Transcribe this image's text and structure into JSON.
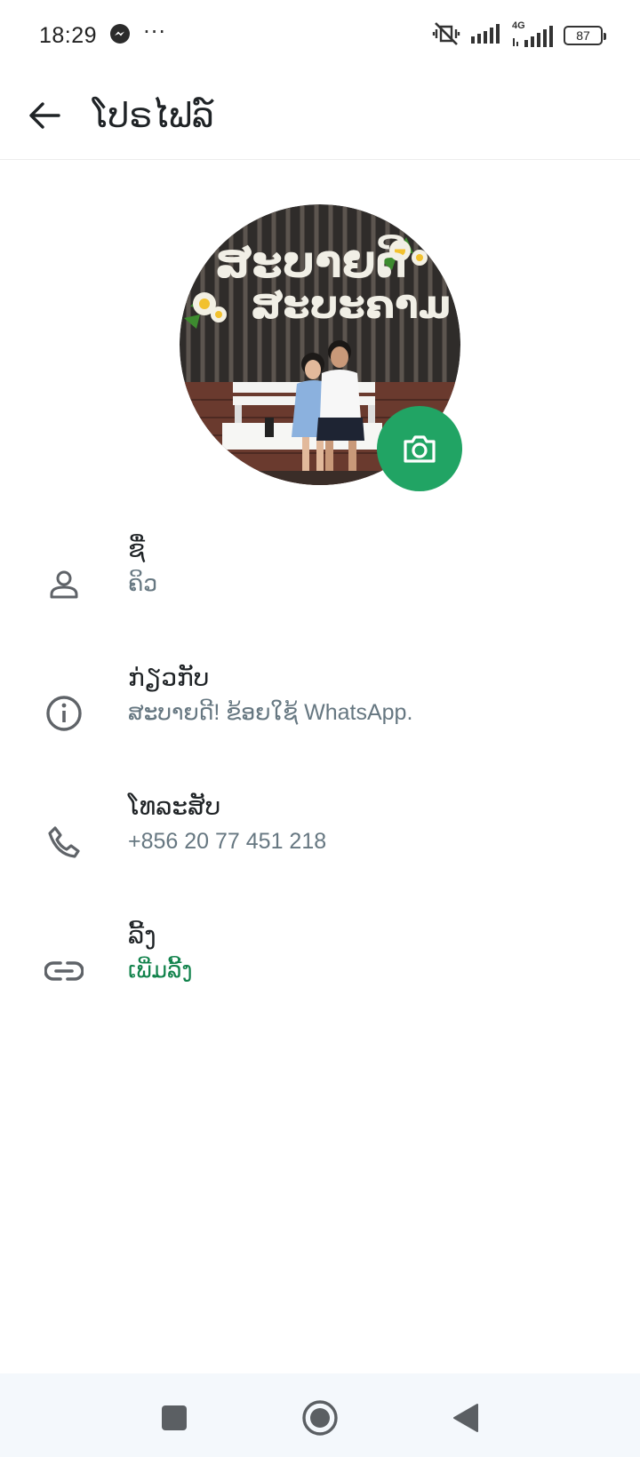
{
  "status_bar": {
    "time": "18:29",
    "dots": "···",
    "battery": "87",
    "network": "4G",
    "icons": [
      "messenger-icon",
      "mute-icon",
      "signal-icon",
      "signal-4g-icon",
      "battery-icon"
    ]
  },
  "header": {
    "title": "ໂປຣໄຟລ໌"
  },
  "avatar": {
    "sign_line1": "ສະບາຍດີ",
    "sign_line2": "ສະບະຄາມ"
  },
  "rows": [
    {
      "icon": "person-icon",
      "label": "ຊື່",
      "value": "ຄິວ"
    },
    {
      "icon": "info-icon",
      "label": "ກ່ຽວກັບ",
      "value": "ສະບາຍດີ! ຂ້ອຍໃຊ້ WhatsApp."
    },
    {
      "icon": "phone-icon",
      "label": "ໂທລະສັບ",
      "value": "+856 20 77 451 218"
    },
    {
      "icon": "link-icon",
      "label": "ລີ້ງ",
      "value": "ເພີ່ມລີ້ງ"
    }
  ],
  "colors": {
    "accent": "#21a464",
    "link": "#11824b",
    "secondary_text": "#667781"
  }
}
